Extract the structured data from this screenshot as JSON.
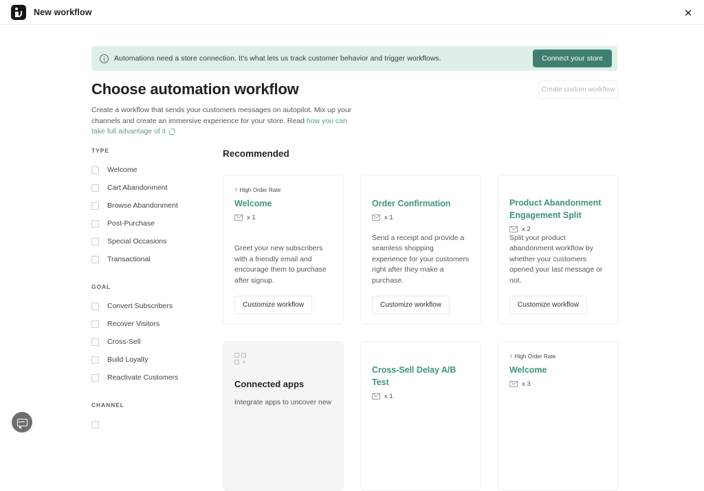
{
  "topbar": {
    "logo_alt": "omnisend-logo",
    "title": "New workflow",
    "close_label": "✕"
  },
  "banner": {
    "text": "Automations need a store connection. It's what lets us track customer behavior and trigger workflows.",
    "button_label": "Connect your store",
    "background": "#dfefe8",
    "button_color": "#3f7f72"
  },
  "header": {
    "title": "Choose automation workflow",
    "custom_button_label": "Create custom workflow",
    "description_part1": "Create a workflow that sends your customers messages on autopilot. Mix up your channels and create an immersive experience for your store. Read ",
    "link_text": "how you can take full advantage of it"
  },
  "filters": [
    {
      "title": "TYPE",
      "options": [
        {
          "label": "Welcome",
          "checked": false
        },
        {
          "label": "Cart Abandonment",
          "checked": false
        },
        {
          "label": "Browse Abandonment",
          "checked": false
        },
        {
          "label": "Post-Purchase",
          "checked": false
        },
        {
          "label": "Special Occasions",
          "checked": false
        },
        {
          "label": "Transactional",
          "checked": false
        }
      ]
    },
    {
      "title": "GOAL",
      "options": [
        {
          "label": "Convert Subscribers",
          "checked": false
        },
        {
          "label": "Recover Visitors",
          "checked": false
        },
        {
          "label": "Cross-Sell",
          "checked": false
        },
        {
          "label": "Build Loyalty",
          "checked": false
        },
        {
          "label": "Reactivate Customers",
          "checked": false
        }
      ]
    },
    {
      "title": "CHANNEL",
      "options": []
    }
  ],
  "main": {
    "section_title": "Recommended",
    "accent_color": "#3f9480",
    "cards": [
      {
        "type": "workflow",
        "badge": "High Order Rate",
        "title": "Welcome",
        "count": "x 1",
        "description": "Greet your new subscribers with a friendly email and encourage them to purchase after signup.",
        "button_label": "Customize workflow"
      },
      {
        "type": "workflow",
        "badge": "",
        "title": "Order Confirmation",
        "count": "x 1",
        "description": "Send a receipt and provide a seamless shopping experience for your customers right after they make a purchase.",
        "button_label": "Customize workflow"
      },
      {
        "type": "workflow",
        "badge": "",
        "title": "Product Abandonment Engagement Split",
        "count": "x 2",
        "description": "Split your product abandonment workflow by whether your customers opened your last message or not.",
        "button_label": "Customize workflow"
      },
      {
        "type": "apps",
        "title": "Connected apps",
        "description": "Integrate apps to uncover new"
      },
      {
        "type": "workflow",
        "badge": "",
        "title": "Cross-Sell Delay A/B Test",
        "count": "x 1",
        "description": "",
        "button_label": ""
      },
      {
        "type": "workflow",
        "badge": "High Order Rate",
        "title": "Welcome",
        "count": "x 3",
        "description": "",
        "button_label": ""
      }
    ]
  },
  "chat": {
    "icon": "chat-bubble-icon"
  }
}
